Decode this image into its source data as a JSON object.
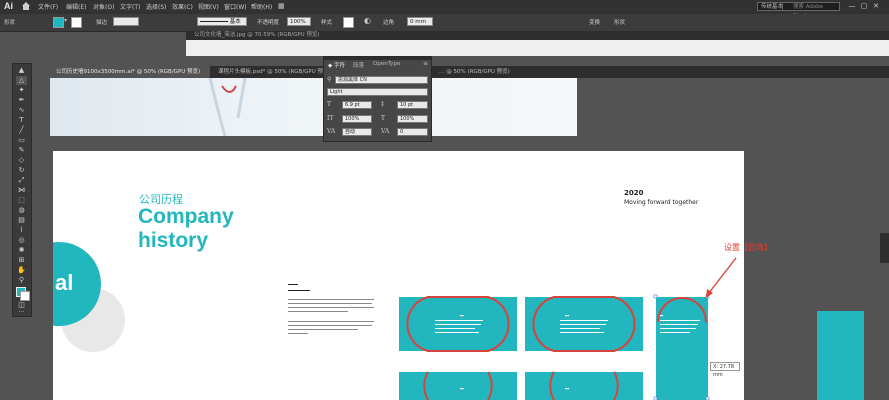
{
  "app": {
    "logo": "Ai",
    "workspace": "传统基本功能",
    "search_placeholder": "搜索 Adobe Stock",
    "window_controls": [
      "—",
      "▢",
      "✕"
    ]
  },
  "menu": [
    "文件(F)",
    "编辑(E)",
    "对象(O)",
    "文字(T)",
    "选择(S)",
    "效果(C)",
    "视图(V)",
    "窗口(W)",
    "帮助(H)"
  ],
  "control_bar": {
    "selection_label": "形状",
    "stroke_label": "描边",
    "stroke_style": "基本",
    "opacity_label": "不透明度",
    "opacity_value": "100%",
    "style_label": "样式",
    "align_label": "形状",
    "transform_label": "变换",
    "corner_label": "边角",
    "corner_value": "0 mm"
  },
  "background_window": {
    "title": "公司文化墙_简洁.jpg @ 70.59% (RGB/GPU 预览)"
  },
  "doc_tabs": [
    "公司历史墙9100x3500mm.ai* @ 50% (RGB/GPU 预览)",
    "公司历史墙9100x3500mm.ai* @ 50% (RGB/GPU 预览)",
    "课程片头模板.psd* @ 50% (RGB/GPU 预览)",
    "… @ 50% (RGB/GPU 预览)"
  ],
  "char_panel": {
    "tabs": [
      "字符",
      "段落",
      "OpenType"
    ],
    "font_family": "思源黑体 CN",
    "font_style": "Light",
    "font_size": "6.9 pt",
    "leading": "10 pt",
    "vscale": "100%",
    "hscale": "100%",
    "kerning": "自动",
    "tracking": "0"
  },
  "artboard": {
    "cn_title": "公司历程",
    "en_title_1": "Company",
    "en_title_2": "history",
    "year": "2020",
    "subtitle": "Moving forward together",
    "big_letter": "al"
  },
  "annotation": "设置【圆角】",
  "coord_readout": "X: 27.78 mm",
  "colors": {
    "teal": "#22b6bf",
    "annotation_red": "#e03a2f",
    "ui_dark": "#323232",
    "canvas_gray": "#535353"
  }
}
